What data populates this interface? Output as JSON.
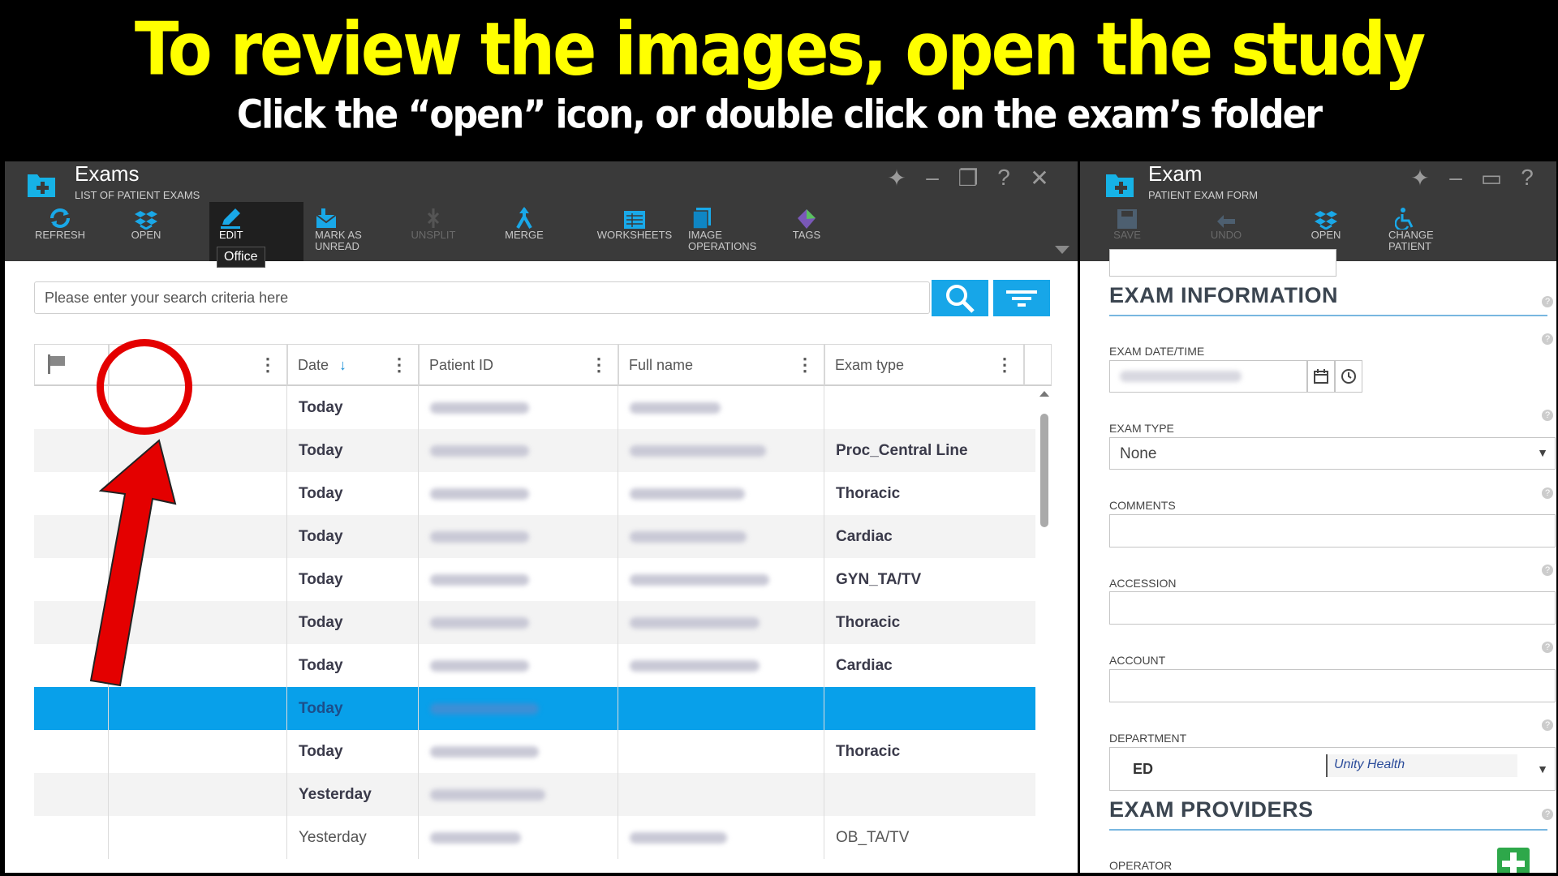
{
  "banner": {
    "title": "To review the images, open the study",
    "subtitle": "Click the “open” icon, or double click on the exam’s folder"
  },
  "left_window": {
    "title": "Exams",
    "subtitle": "LIST OF PATIENT EXAMS",
    "toolbar": [
      {
        "label": "REFRESH",
        "icon": "refresh-icon",
        "state": "enabled"
      },
      {
        "label": "OPEN",
        "icon": "open-folder-icon",
        "state": "enabled"
      },
      {
        "label": "EDIT",
        "icon": "edit-pencil-icon",
        "state": "active"
      },
      {
        "label": "MARK AS UNREAD",
        "icon": "mark-unread-icon",
        "state": "enabled"
      },
      {
        "label": "UNSPLIT",
        "icon": "unsplit-icon",
        "state": "disabled"
      },
      {
        "label": "MERGE",
        "icon": "merge-icon",
        "state": "enabled"
      },
      {
        "label": "WORKSHEETS",
        "icon": "worksheets-icon",
        "state": "enabled"
      },
      {
        "label": "IMAGE OPERATIONS",
        "icon": "image-operations-icon",
        "state": "enabled"
      },
      {
        "label": "TAGS",
        "icon": "tags-icon",
        "state": "enabled"
      }
    ],
    "tooltip": "Office",
    "search_placeholder": "Please enter your search criteria here",
    "columns": [
      "",
      "",
      "Date",
      "Patient ID",
      "Full name",
      "Exam type"
    ],
    "rows": [
      {
        "date": "Today",
        "exam_type": "",
        "patient_id_redacted": true,
        "name_redacted": true,
        "bold": true,
        "selected": false
      },
      {
        "date": "Today",
        "exam_type": "Proc_Central Line",
        "patient_id_redacted": true,
        "name_redacted": true,
        "bold": true,
        "selected": false
      },
      {
        "date": "Today",
        "exam_type": "Thoracic",
        "patient_id_redacted": true,
        "name_redacted": true,
        "bold": true,
        "selected": false
      },
      {
        "date": "Today",
        "exam_type": "Cardiac",
        "patient_id_redacted": true,
        "name_redacted": true,
        "bold": true,
        "selected": false
      },
      {
        "date": "Today",
        "exam_type": "GYN_TA/TV",
        "patient_id_redacted": true,
        "name_redacted": true,
        "bold": true,
        "selected": false
      },
      {
        "date": "Today",
        "exam_type": "Thoracic",
        "patient_id_redacted": true,
        "name_redacted": true,
        "bold": true,
        "selected": false
      },
      {
        "date": "Today",
        "exam_type": "Cardiac",
        "patient_id_redacted": true,
        "name_redacted": true,
        "bold": true,
        "selected": false
      },
      {
        "date": "Today",
        "exam_type": "",
        "patient_id_redacted": true,
        "name_redacted": false,
        "bold": true,
        "selected": true
      },
      {
        "date": "Today",
        "exam_type": "Thoracic",
        "patient_id_redacted": true,
        "name_redacted": false,
        "bold": true,
        "selected": false
      },
      {
        "date": "Yesterday",
        "exam_type": "",
        "patient_id_redacted": true,
        "name_redacted": false,
        "bold": true,
        "selected": false
      },
      {
        "date": "Yesterday",
        "exam_type": "OB_TA/TV",
        "patient_id_redacted": true,
        "name_redacted": true,
        "bold": false,
        "selected": false
      }
    ]
  },
  "right_window": {
    "title": "Exam",
    "subtitle": "PATIENT EXAM FORM",
    "toolbar": [
      {
        "label": "SAVE",
        "icon": "save-icon",
        "state": "disabled"
      },
      {
        "label": "UNDO",
        "icon": "undo-icon",
        "state": "disabled"
      },
      {
        "label": "OPEN",
        "icon": "open-folder-icon",
        "state": "enabled"
      },
      {
        "label": "CHANGE PATIENT",
        "icon": "change-patient-icon",
        "state": "enabled"
      }
    ],
    "section_exam_info": "EXAM INFORMATION",
    "label_exam_datetime": "EXAM DATE/TIME",
    "label_exam_type": "EXAM TYPE",
    "exam_type_value": "None",
    "label_comments": "COMMENTS",
    "label_accession": "ACCESSION",
    "label_account": "ACCOUNT",
    "label_department": "DEPARTMENT",
    "department_value": "ED",
    "department_org": "Unity Health",
    "section_providers": "EXAM PROVIDERS",
    "label_operator": "OPERATOR"
  },
  "colors": {
    "banner_title": "#ffff00",
    "accent": "#17a6e8",
    "selected_row": "#08a0ea",
    "annotation": "#e40000",
    "toolbar_bg": "#3a3a3a"
  }
}
